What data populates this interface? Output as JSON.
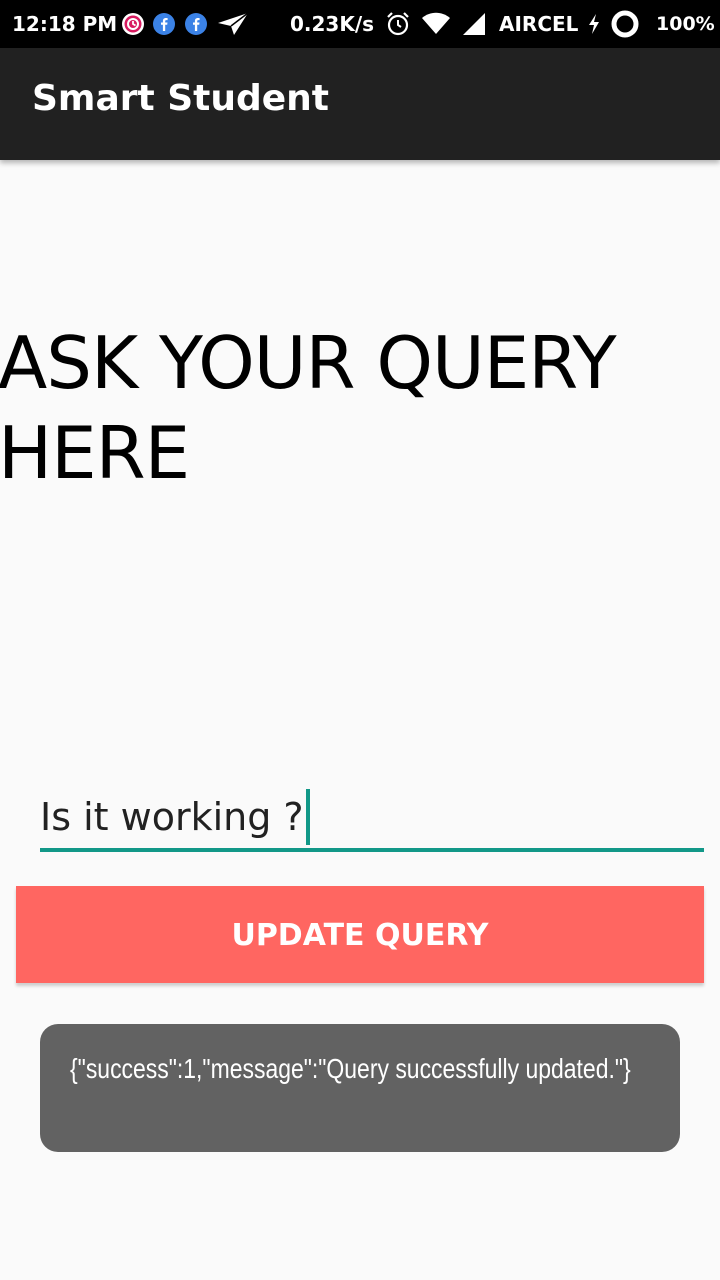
{
  "status_bar": {
    "time": "12:18 PM",
    "net_speed": "0.23K/s",
    "carrier": "AIRCEL",
    "battery_percent": "100%",
    "icons": [
      "notification-app-icon",
      "facebook-icon",
      "facebook-icon",
      "send-icon",
      "alarm-icon",
      "wifi-icon",
      "signal-icon",
      "charging-icon",
      "battery-icon"
    ]
  },
  "app_bar": {
    "title": "Smart Student",
    "color": "#212121"
  },
  "main": {
    "heading": "ASK YOUR QUERY HERE",
    "query_input_value": "Is it working ?",
    "accent_color": "#129888",
    "button_label": "UPDATE QUERY",
    "button_color": "#ff6661"
  },
  "toast": {
    "message": "{\"success\":1,\"message\":\"Query successfully updated.\"}"
  }
}
